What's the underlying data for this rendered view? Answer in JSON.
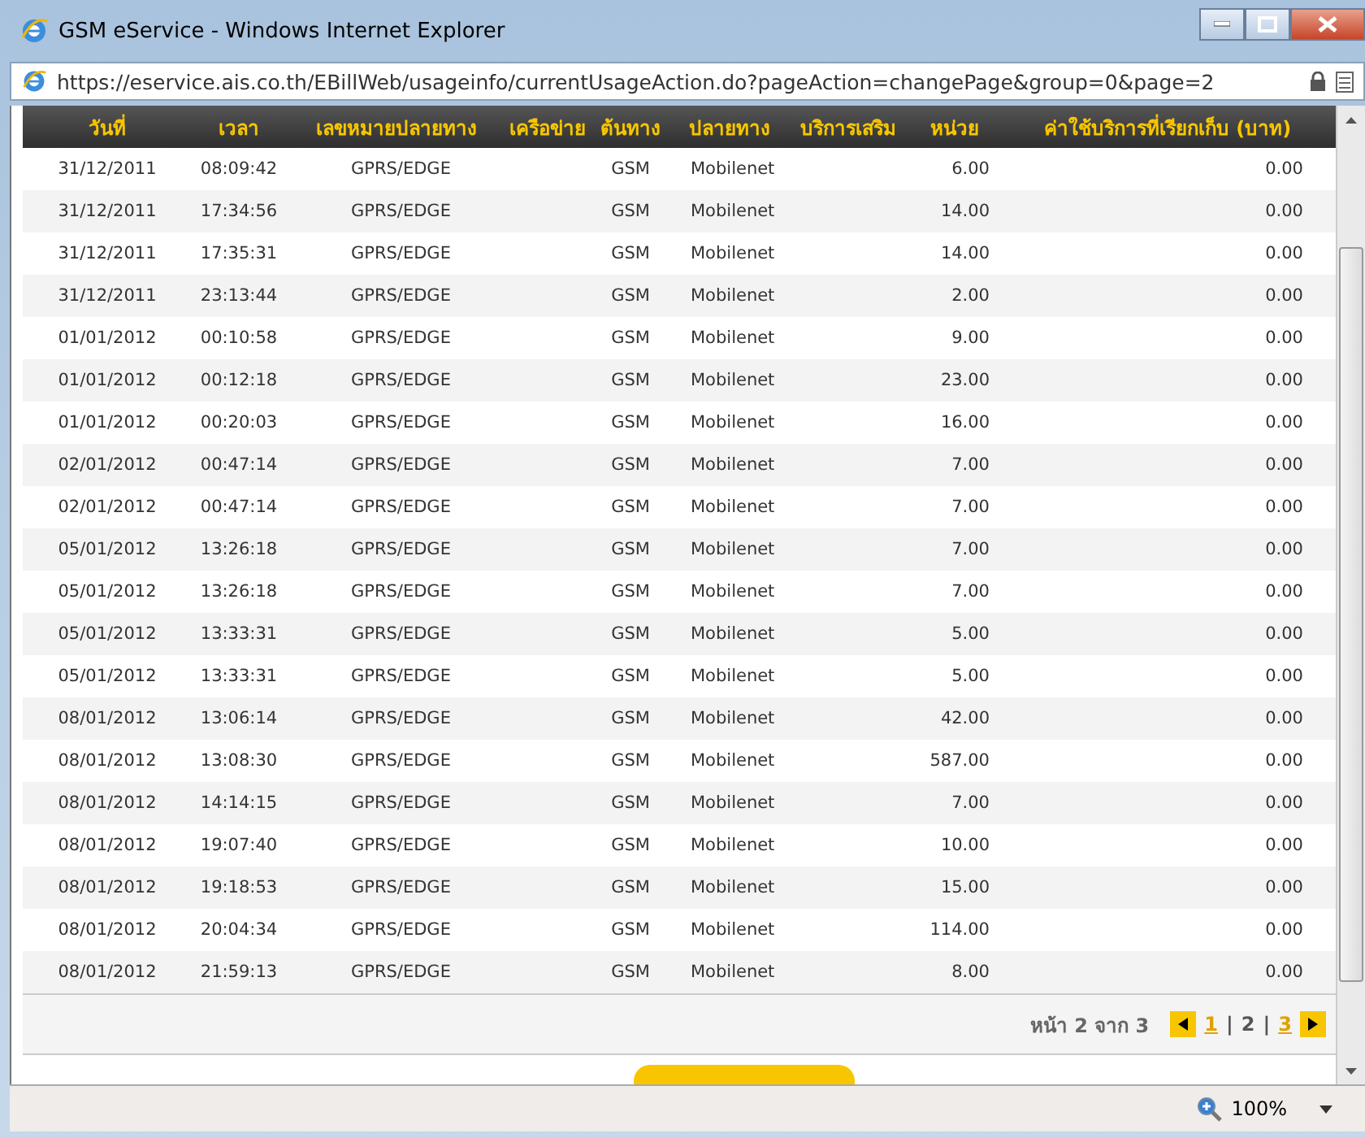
{
  "window": {
    "title": "GSM eService - Windows Internet Explorer"
  },
  "address": {
    "url": "https://eservice.ais.co.th/EBillWeb/usageinfo/currentUsageAction.do?pageAction=changePage&group=0&page=2"
  },
  "table": {
    "columns": [
      "วันที่",
      "เวลา",
      "เลขหมายปลายทาง",
      "เครือข่าย",
      "ต้นทาง",
      "ปลายทาง",
      "บริการเสริม",
      "หน่วย",
      "ค่าใช้บริการที่เรียกเก็บ (บาท)"
    ],
    "rows": [
      [
        "31/12/2011",
        "08:09:42",
        "GPRS/EDGE",
        "",
        "GSM",
        "Mobilenet",
        "",
        "6.00",
        "0.00"
      ],
      [
        "31/12/2011",
        "17:34:56",
        "GPRS/EDGE",
        "",
        "GSM",
        "Mobilenet",
        "",
        "14.00",
        "0.00"
      ],
      [
        "31/12/2011",
        "17:35:31",
        "GPRS/EDGE",
        "",
        "GSM",
        "Mobilenet",
        "",
        "14.00",
        "0.00"
      ],
      [
        "31/12/2011",
        "23:13:44",
        "GPRS/EDGE",
        "",
        "GSM",
        "Mobilenet",
        "",
        "2.00",
        "0.00"
      ],
      [
        "01/01/2012",
        "00:10:58",
        "GPRS/EDGE",
        "",
        "GSM",
        "Mobilenet",
        "",
        "9.00",
        "0.00"
      ],
      [
        "01/01/2012",
        "00:12:18",
        "GPRS/EDGE",
        "",
        "GSM",
        "Mobilenet",
        "",
        "23.00",
        "0.00"
      ],
      [
        "01/01/2012",
        "00:20:03",
        "GPRS/EDGE",
        "",
        "GSM",
        "Mobilenet",
        "",
        "16.00",
        "0.00"
      ],
      [
        "02/01/2012",
        "00:47:14",
        "GPRS/EDGE",
        "",
        "GSM",
        "Mobilenet",
        "",
        "7.00",
        "0.00"
      ],
      [
        "02/01/2012",
        "00:47:14",
        "GPRS/EDGE",
        "",
        "GSM",
        "Mobilenet",
        "",
        "7.00",
        "0.00"
      ],
      [
        "05/01/2012",
        "13:26:18",
        "GPRS/EDGE",
        "",
        "GSM",
        "Mobilenet",
        "",
        "7.00",
        "0.00"
      ],
      [
        "05/01/2012",
        "13:26:18",
        "GPRS/EDGE",
        "",
        "GSM",
        "Mobilenet",
        "",
        "7.00",
        "0.00"
      ],
      [
        "05/01/2012",
        "13:33:31",
        "GPRS/EDGE",
        "",
        "GSM",
        "Mobilenet",
        "",
        "5.00",
        "0.00"
      ],
      [
        "05/01/2012",
        "13:33:31",
        "GPRS/EDGE",
        "",
        "GSM",
        "Mobilenet",
        "",
        "5.00",
        "0.00"
      ],
      [
        "08/01/2012",
        "13:06:14",
        "GPRS/EDGE",
        "",
        "GSM",
        "Mobilenet",
        "",
        "42.00",
        "0.00"
      ],
      [
        "08/01/2012",
        "13:08:30",
        "GPRS/EDGE",
        "",
        "GSM",
        "Mobilenet",
        "",
        "587.00",
        "0.00"
      ],
      [
        "08/01/2012",
        "14:14:15",
        "GPRS/EDGE",
        "",
        "GSM",
        "Mobilenet",
        "",
        "7.00",
        "0.00"
      ],
      [
        "08/01/2012",
        "19:07:40",
        "GPRS/EDGE",
        "",
        "GSM",
        "Mobilenet",
        "",
        "10.00",
        "0.00"
      ],
      [
        "08/01/2012",
        "19:18:53",
        "GPRS/EDGE",
        "",
        "GSM",
        "Mobilenet",
        "",
        "15.00",
        "0.00"
      ],
      [
        "08/01/2012",
        "20:04:34",
        "GPRS/EDGE",
        "",
        "GSM",
        "Mobilenet",
        "",
        "114.00",
        "0.00"
      ],
      [
        "08/01/2012",
        "21:59:13",
        "GPRS/EDGE",
        "",
        "GSM",
        "Mobilenet",
        "",
        "8.00",
        "0.00"
      ]
    ]
  },
  "pagination": {
    "label": "หน้า 2 จาก 3",
    "separator": "|",
    "pages": [
      {
        "label": "1",
        "selected": false
      },
      {
        "label": "2",
        "selected": true
      },
      {
        "label": "3",
        "selected": false
      }
    ]
  },
  "status_bar": {
    "zoom": "100%"
  }
}
